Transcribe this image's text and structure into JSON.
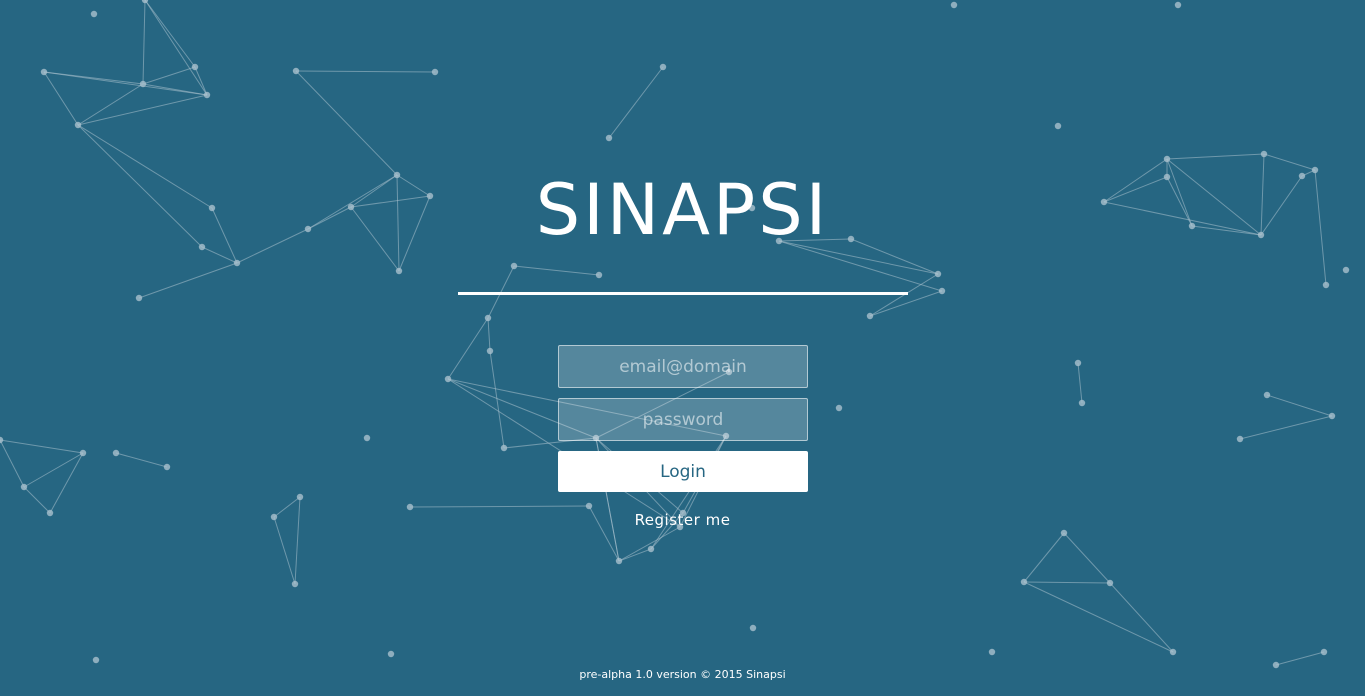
{
  "app": {
    "title": "SINAPSI",
    "background_color": "#266682",
    "network_color": "#a9c1cd"
  },
  "login_form": {
    "email_placeholder": "email@domain",
    "password_placeholder": "password",
    "login_label": "Login",
    "register_label": "Register me"
  },
  "footer": {
    "text": "pre-alpha 1.0 version © 2015 Sinapsi"
  },
  "background_graphic": {
    "type": "network-of-dots-and-lines",
    "decorative": true
  }
}
